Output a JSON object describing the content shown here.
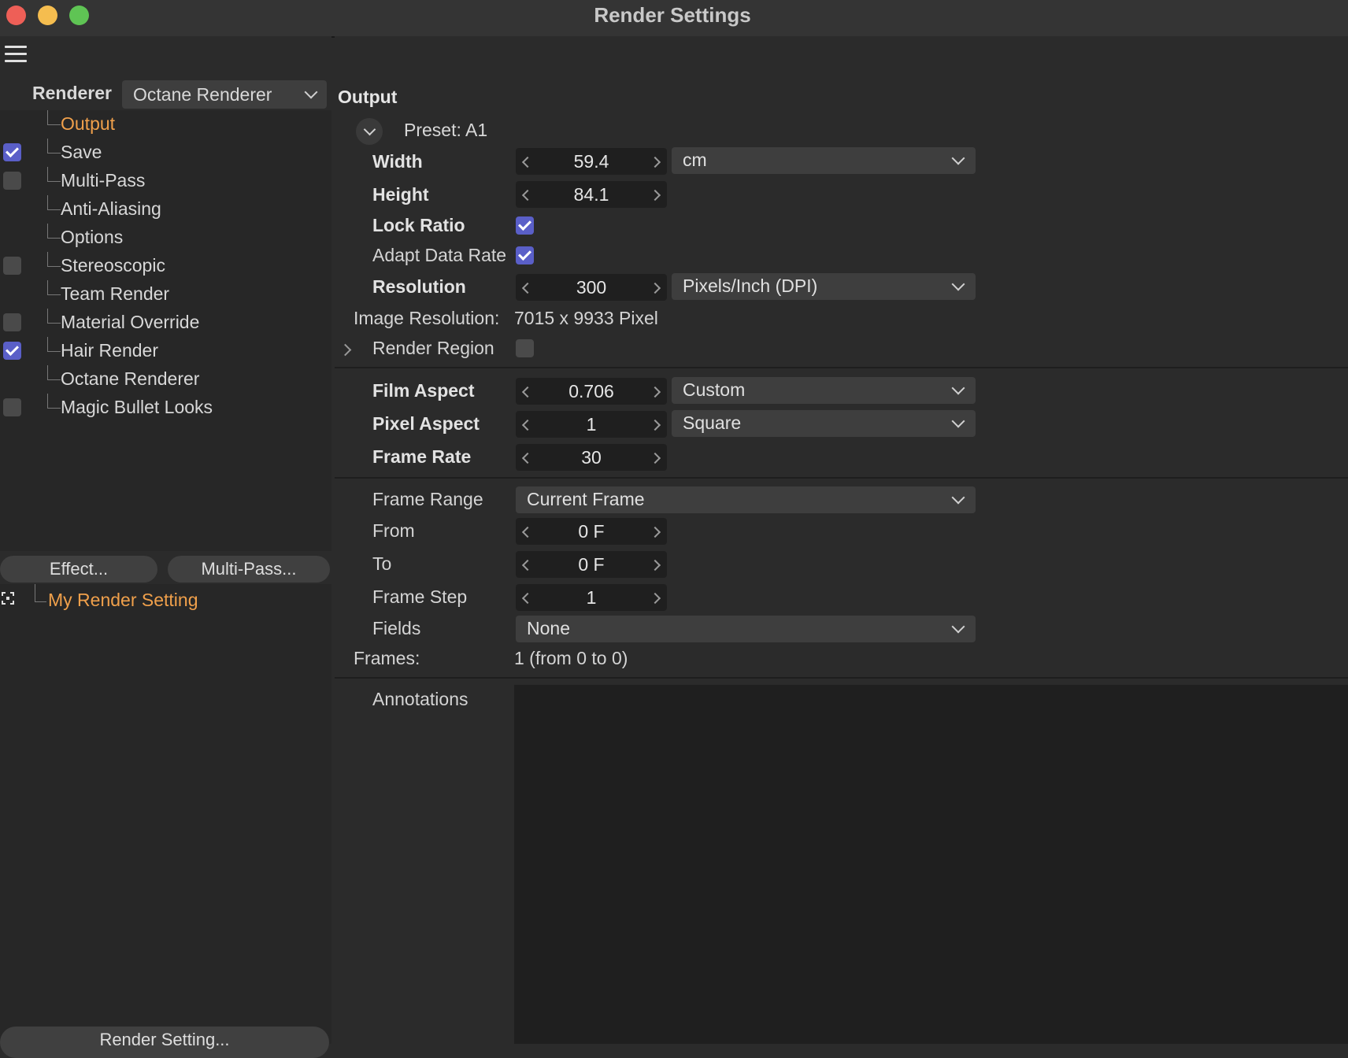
{
  "window": {
    "title": "Render Settings"
  },
  "left_panel": {
    "renderer_label": "Renderer",
    "renderer_value": "Octane Renderer",
    "tree": [
      {
        "label": "Output",
        "checkbox": "none",
        "active": true
      },
      {
        "label": "Save",
        "checkbox": "on"
      },
      {
        "label": "Multi-Pass",
        "checkbox": "off"
      },
      {
        "label": "Anti-Aliasing",
        "checkbox": "none"
      },
      {
        "label": "Options",
        "checkbox": "none"
      },
      {
        "label": "Stereoscopic",
        "checkbox": "off"
      },
      {
        "label": "Team Render",
        "checkbox": "none"
      },
      {
        "label": "Material Override",
        "checkbox": "off"
      },
      {
        "label": "Hair Render",
        "checkbox": "on"
      },
      {
        "label": "Octane Renderer",
        "checkbox": "none"
      },
      {
        "label": "Magic Bullet Looks",
        "checkbox": "off"
      }
    ],
    "effect_button": "Effect...",
    "multipass_button": "Multi-Pass...",
    "render_setting_item": "My Render Setting",
    "render_setting_button": "Render Setting..."
  },
  "output": {
    "title": "Output",
    "preset": "Preset: A1",
    "width_label": "Width",
    "width_value": "59.4",
    "width_unit": "cm",
    "height_label": "Height",
    "height_value": "84.1",
    "lock_ratio_label": "Lock Ratio",
    "lock_ratio_checked": true,
    "adapt_label": "Adapt Data Rate",
    "adapt_checked": true,
    "resolution_label": "Resolution",
    "resolution_value": "300",
    "resolution_unit": "Pixels/Inch (DPI)",
    "image_res_label": "Image Resolution:",
    "image_res_value": "7015 x 9933 Pixel",
    "render_region_label": "Render Region",
    "render_region_checked": false,
    "film_aspect_label": "Film Aspect",
    "film_aspect_value": "0.706",
    "film_aspect_mode": "Custom",
    "pixel_aspect_label": "Pixel Aspect",
    "pixel_aspect_value": "1",
    "pixel_aspect_mode": "Square",
    "frame_rate_label": "Frame Rate",
    "frame_rate_value": "30",
    "frame_range_label": "Frame Range",
    "frame_range_value": "Current Frame",
    "from_label": "From",
    "from_value": "0 F",
    "to_label": "To",
    "to_value": "0 F",
    "frame_step_label": "Frame Step",
    "frame_step_value": "1",
    "fields_label": "Fields",
    "fields_value": "None",
    "frames_label": "Frames:",
    "frames_value": "1 (from 0 to 0)",
    "annotations_label": "Annotations"
  },
  "colors": {
    "accent": "#f0a04b",
    "checkbox": "#5a5fc8"
  }
}
